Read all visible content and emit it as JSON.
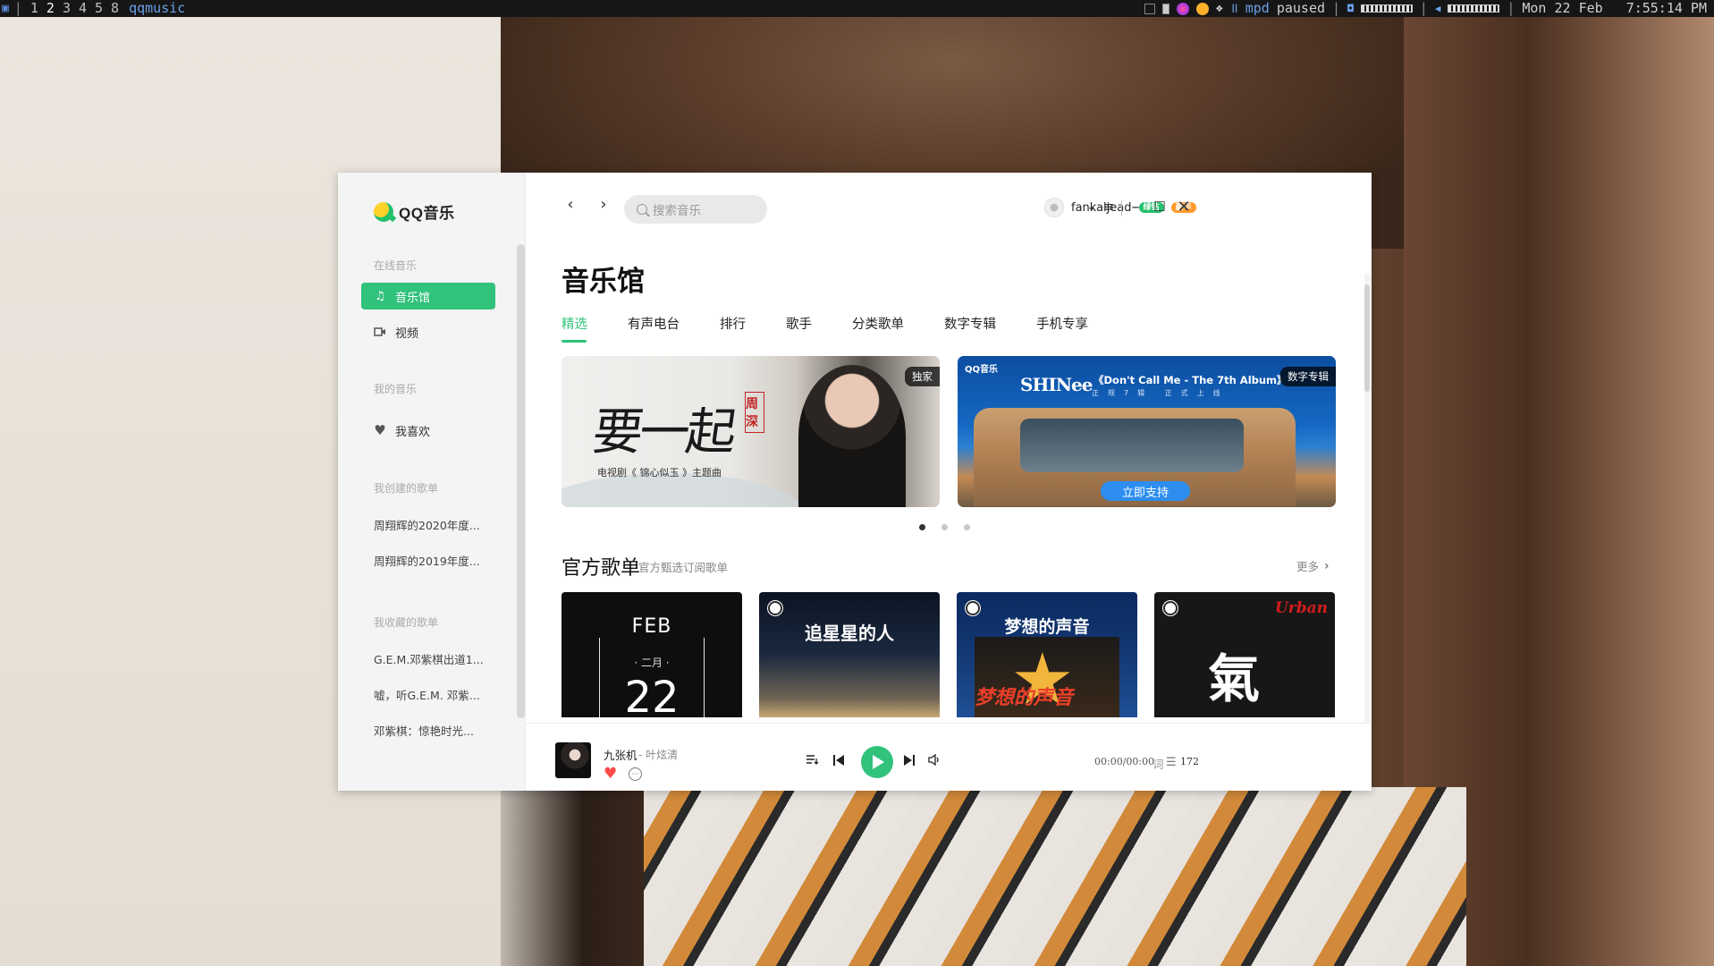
{
  "topbar": {
    "workspaces": [
      "1",
      "2",
      "3",
      "4",
      "5",
      "8"
    ],
    "active_workspace": "2",
    "app": "qqmusic",
    "mpd_label": "mpd",
    "mpd_status": "paused",
    "date": "Mon 22 Feb",
    "time": "7:55:14 PM"
  },
  "app": {
    "logo_text": "QQ音乐"
  },
  "sidebar": {
    "online_music_heading": "在线音乐",
    "online_items": [
      {
        "label": "音乐馆",
        "icon": "music-note-icon"
      },
      {
        "label": "视频",
        "icon": "video-icon"
      }
    ],
    "my_music_heading": "我的音乐",
    "my_items": [
      {
        "label": "我喜欢",
        "icon": "heart-icon"
      }
    ],
    "created_heading": "我创建的歌单",
    "created_playlists": [
      "周翔辉的2020年度...",
      "周翔辉的2019年度..."
    ],
    "collected_heading": "我收藏的歌单",
    "collected_playlists": [
      "G.E.M.邓紫棋出道1...",
      "嘘，听G.E.M. 邓紫...",
      "邓紫棋：惊艳时光..."
    ]
  },
  "header": {
    "search_placeholder": "搜索音乐",
    "username": "fankaljead",
    "badge_green": "绿钻",
    "badge_orange": "豪华"
  },
  "main": {
    "title": "音乐馆",
    "tabs": [
      "精选",
      "有声电台",
      "排行",
      "歌手",
      "分类歌单",
      "数字专辑",
      "手机专享"
    ],
    "active_tab": 0,
    "banners": [
      {
        "tag": "独家",
        "calligraphy": "要一起",
        "seal": "周深",
        "subtitle": "电视剧《 锦心似玉 》主题曲"
      },
      {
        "tag": "数字专辑",
        "brand": "QQ音乐",
        "artist": "SHINee",
        "album": "《Don't Call Me - The 7th Album》",
        "release_note": "正规7辑 正式上线",
        "button": "立即支持"
      }
    ],
    "carousel_pages": 3,
    "carousel_active": 0,
    "section": {
      "title": "官方歌单",
      "subtitle": "官方甄选订阅歌单",
      "more": "更多"
    },
    "playlists": [
      {
        "month": "FEB",
        "month_cn": "· 二月 ·",
        "day": "22"
      },
      {
        "title": "追星星的人"
      },
      {
        "title": "梦想的声音",
        "logo": "梦想的声音"
      },
      {
        "label": "Urban",
        "mark": "氣"
      }
    ]
  },
  "player": {
    "song": "九张机",
    "artist": "- 叶炫清",
    "time": "00:00/00:00",
    "lyric_label": "词",
    "playlist_count": "172"
  },
  "colors": {
    "accent": "#31c27c",
    "like": "#ff4b4b"
  }
}
